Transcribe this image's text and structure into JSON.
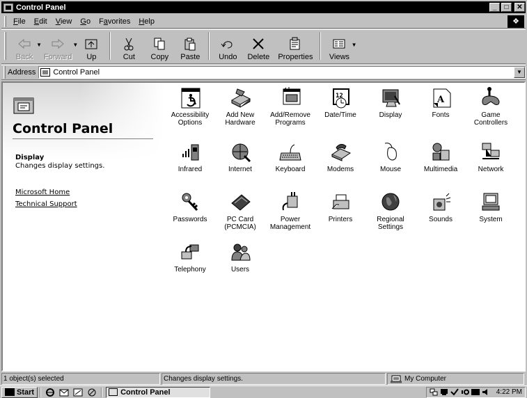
{
  "window": {
    "title": "Control Panel"
  },
  "menu": [
    {
      "label": "File",
      "mnemonic": "F",
      "rest": "ile"
    },
    {
      "label": "Edit",
      "mnemonic": "E",
      "rest": "dit"
    },
    {
      "label": "View",
      "mnemonic": "V",
      "rest": "iew"
    },
    {
      "label": "Go",
      "mnemonic": "G",
      "rest": "o"
    },
    {
      "label": "Favorites",
      "mnemonic": "a",
      "pre": "F",
      "rest": "vorites"
    },
    {
      "label": "Help",
      "mnemonic": "H",
      "rest": "elp"
    }
  ],
  "toolbar": {
    "back": "Back",
    "forward": "Forward",
    "up": "Up",
    "cut": "Cut",
    "copy": "Copy",
    "paste": "Paste",
    "undo": "Undo",
    "delete": "Delete",
    "properties": "Properties",
    "views": "Views"
  },
  "address": {
    "label": "Address",
    "value": "Control Panel"
  },
  "leftpane": {
    "title": "Control Panel",
    "selected_name": "Display",
    "selected_desc": "Changes display settings.",
    "links": [
      "Microsoft Home",
      "Technical Support"
    ]
  },
  "icons": [
    {
      "label": "Accessibility\nOptions",
      "icon": "accessibility-icon"
    },
    {
      "label": "Add New\nHardware",
      "icon": "add-hardware-icon"
    },
    {
      "label": "Add/Remove\nPrograms",
      "icon": "add-remove-programs-icon"
    },
    {
      "label": "Date/Time",
      "icon": "date-time-icon"
    },
    {
      "label": "Display",
      "icon": "display-icon"
    },
    {
      "label": "Fonts",
      "icon": "fonts-icon"
    },
    {
      "label": "Game\nControllers",
      "icon": "game-controllers-icon"
    },
    {
      "label": "Infrared",
      "icon": "infrared-icon"
    },
    {
      "label": "Internet",
      "icon": "internet-icon"
    },
    {
      "label": "Keyboard",
      "icon": "keyboard-icon"
    },
    {
      "label": "Modems",
      "icon": "modems-icon"
    },
    {
      "label": "Mouse",
      "icon": "mouse-icon"
    },
    {
      "label": "Multimedia",
      "icon": "multimedia-icon"
    },
    {
      "label": "Network",
      "icon": "network-icon"
    },
    {
      "label": "Passwords",
      "icon": "passwords-icon"
    },
    {
      "label": "PC Card\n(PCMCIA)",
      "icon": "pc-card-icon"
    },
    {
      "label": "Power\nManagement",
      "icon": "power-management-icon"
    },
    {
      "label": "Printers",
      "icon": "printers-icon"
    },
    {
      "label": "Regional\nSettings",
      "icon": "regional-settings-icon"
    },
    {
      "label": "Sounds",
      "icon": "sounds-icon"
    },
    {
      "label": "System",
      "icon": "system-icon"
    },
    {
      "label": "Telephony",
      "icon": "telephony-icon"
    },
    {
      "label": "Users",
      "icon": "users-icon"
    }
  ],
  "statusbar": {
    "selection": "1 object(s) selected",
    "description": "Changes display settings.",
    "zone": "My Computer"
  },
  "taskbar": {
    "start": "Start",
    "task": "Control Panel",
    "clock": "4:22 PM"
  }
}
